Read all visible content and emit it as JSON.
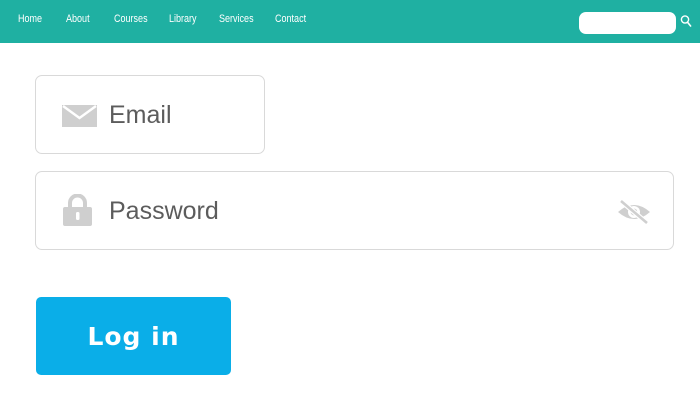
{
  "nav": {
    "items": [
      {
        "label": "Home"
      },
      {
        "label": "About"
      },
      {
        "label": "Courses"
      },
      {
        "label": "Library"
      },
      {
        "label": "Services"
      },
      {
        "label": "Contact"
      }
    ],
    "search": {
      "placeholder": "",
      "value": ""
    },
    "search_icon": "search-icon"
  },
  "form": {
    "email": {
      "placeholder": "Email",
      "value": "",
      "icon": "envelope-icon"
    },
    "password": {
      "placeholder": "Password",
      "value": "",
      "icon": "lock-icon",
      "toggle_icon": "eye-slash-icon"
    },
    "login_label": "Log in"
  },
  "colors": {
    "navbar": "#1fb0a2",
    "button": "#0aaee8",
    "field_border": "#d9d9d9",
    "icon": "#cfcfcf"
  }
}
